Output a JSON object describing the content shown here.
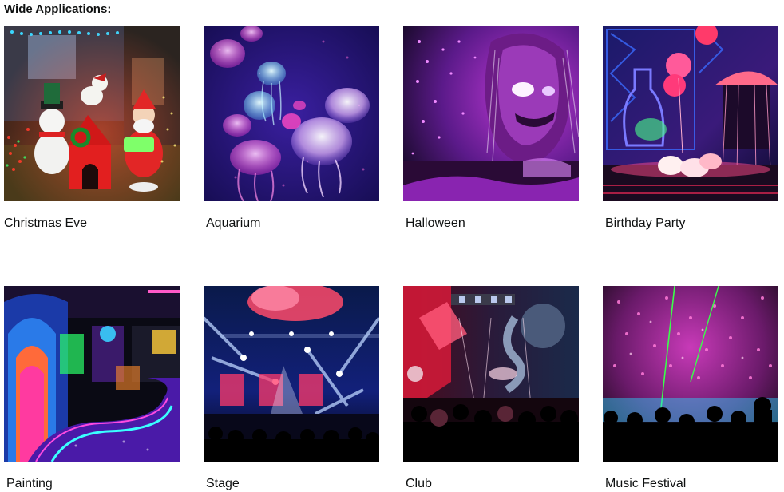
{
  "section": {
    "heading": "Wide Applications:"
  },
  "cards": [
    {
      "label": "Christmas Eve",
      "image": "christmas-eve-scene"
    },
    {
      "label": "Aquarium",
      "image": "aquarium-jellyfish-scene"
    },
    {
      "label": "Halloween",
      "image": "halloween-ghoul-scene"
    },
    {
      "label": "Birthday Party",
      "image": "birthday-party-scene"
    },
    {
      "label": "Painting",
      "image": "blacklight-painting-scene"
    },
    {
      "label": "Stage",
      "image": "stage-lights-scene"
    },
    {
      "label": "Club",
      "image": "club-crowd-scene"
    },
    {
      "label": "Music Festival",
      "image": "music-festival-scene"
    }
  ]
}
